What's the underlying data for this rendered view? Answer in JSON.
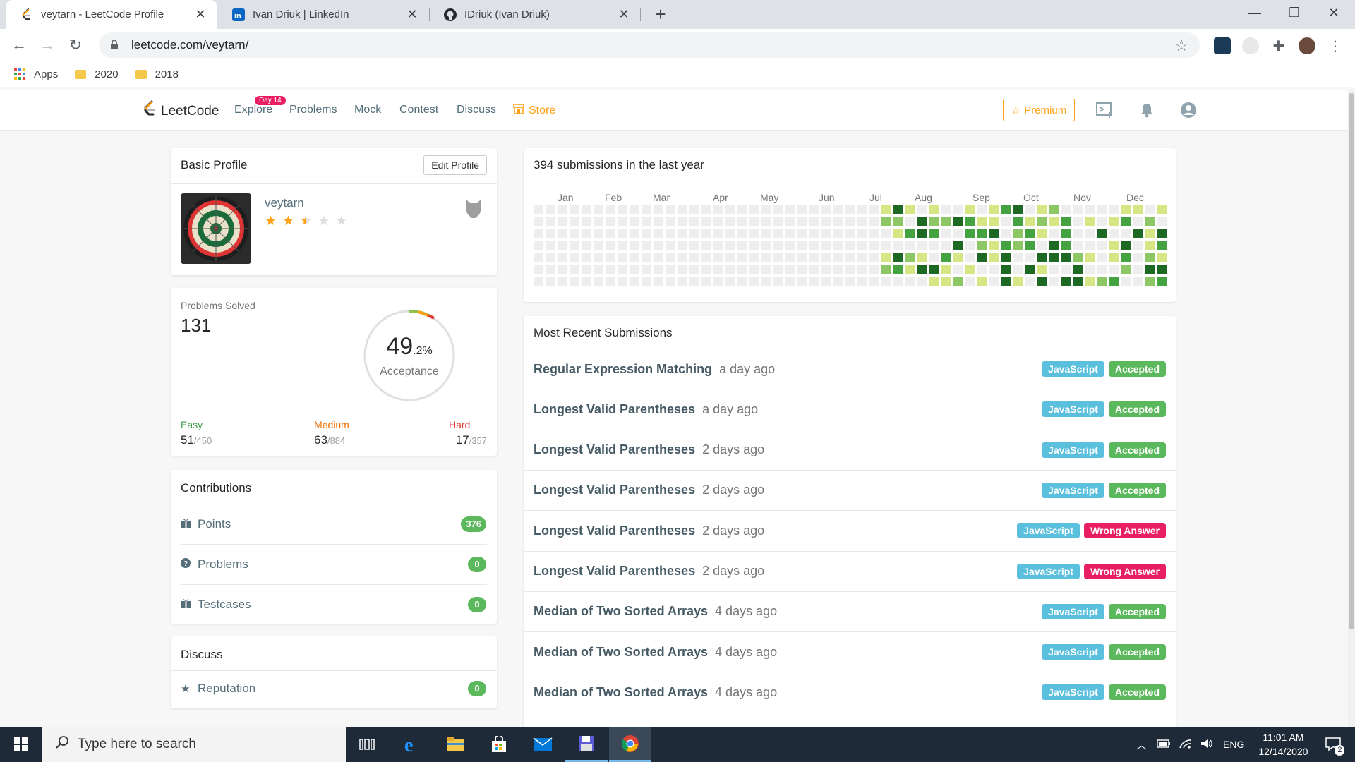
{
  "browser": {
    "tabs": [
      {
        "title": "veytarn - LeetCode Profile",
        "icon": "leetcode-icon",
        "active": true
      },
      {
        "title": "Ivan Driuk | LinkedIn",
        "icon": "linkedin-icon",
        "active": false
      },
      {
        "title": "IDriuk (Ivan Driuk)",
        "icon": "github-icon",
        "active": false
      }
    ],
    "url": "leetcode.com/veytarn/",
    "bookmarks": [
      "Apps",
      "2020",
      "2018"
    ]
  },
  "nav": {
    "logo": "LeetCode",
    "explore": "Explore",
    "explore_badge": "Day 14",
    "problems": "Problems",
    "mock": "Mock",
    "contest": "Contest",
    "discuss": "Discuss",
    "store": "Store",
    "premium": "Premium"
  },
  "profile": {
    "title": "Basic Profile",
    "edit_button": "Edit Profile",
    "username": "veytarn",
    "rating_stars": 2.5,
    "rating_max": 5
  },
  "solved": {
    "label": "Problems Solved",
    "count": "131",
    "acceptance_int": "49",
    "acceptance_dec": ".2%",
    "acceptance_label": "Acceptance",
    "acceptance_value": 49.2,
    "easy_label": "Easy",
    "easy_solved": "51",
    "easy_total": "/450",
    "medium_label": "Medium",
    "medium_solved": "63",
    "medium_total": "/884",
    "hard_label": "Hard",
    "hard_solved": "17",
    "hard_total": "/357"
  },
  "contributions": {
    "title": "Contributions",
    "items": [
      {
        "label": "Points",
        "value": "376",
        "icon": "gift-icon"
      },
      {
        "label": "Problems",
        "value": "0",
        "icon": "question-circle-icon"
      },
      {
        "label": "Testcases",
        "value": "0",
        "icon": "gift-icon"
      }
    ]
  },
  "discuss": {
    "title": "Discuss",
    "items": [
      {
        "label": "Reputation",
        "value": "0",
        "icon": "star-icon"
      }
    ]
  },
  "calendar": {
    "title": "394 submissions in the last year",
    "months": [
      "Jan",
      "Feb",
      "Mar",
      "Apr",
      "May",
      "Jun",
      "Jul",
      "Aug",
      "Sep",
      "Oct",
      "Nov",
      "Dec"
    ],
    "colors": {
      "empty": "#eeeeee",
      "l1": "#d6e685",
      "l2": "#8cc665",
      "l3": "#44a340",
      "l4": "#1e6823"
    }
  },
  "recent": {
    "title": "Most Recent Submissions",
    "items": [
      {
        "title": "Regular Expression Matching",
        "time": "a day ago",
        "lang": "JavaScript",
        "status": "Accepted"
      },
      {
        "title": "Longest Valid Parentheses",
        "time": "a day ago",
        "lang": "JavaScript",
        "status": "Accepted"
      },
      {
        "title": "Longest Valid Parentheses",
        "time": "2 days ago",
        "lang": "JavaScript",
        "status": "Accepted"
      },
      {
        "title": "Longest Valid Parentheses",
        "time": "2 days ago",
        "lang": "JavaScript",
        "status": "Accepted"
      },
      {
        "title": "Longest Valid Parentheses",
        "time": "2 days ago",
        "lang": "JavaScript",
        "status": "Wrong Answer"
      },
      {
        "title": "Longest Valid Parentheses",
        "time": "2 days ago",
        "lang": "JavaScript",
        "status": "Wrong Answer"
      },
      {
        "title": "Median of Two Sorted Arrays",
        "time": "4 days ago",
        "lang": "JavaScript",
        "status": "Accepted"
      },
      {
        "title": "Median of Two Sorted Arrays",
        "time": "4 days ago",
        "lang": "JavaScript",
        "status": "Accepted"
      },
      {
        "title": "Median of Two Sorted Arrays",
        "time": "4 days ago",
        "lang": "JavaScript",
        "status": "Accepted"
      }
    ]
  },
  "taskbar": {
    "search_placeholder": "Type here to search",
    "time": "11:01 AM",
    "date": "12/14/2020",
    "lang": "ENG",
    "notifications": "2"
  }
}
